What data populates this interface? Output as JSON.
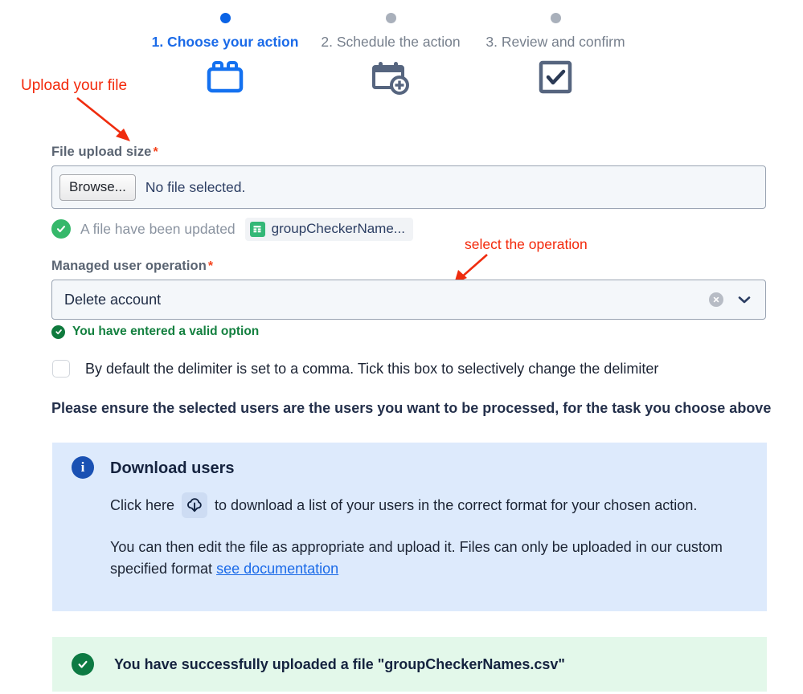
{
  "stepper": {
    "steps": [
      {
        "label": "1. Choose your action",
        "state": "active",
        "icon": "toolbox-icon"
      },
      {
        "label": "2. Schedule the action",
        "state": "inactive",
        "icon": "calendar-add-icon"
      },
      {
        "label": "3. Review and confirm",
        "state": "inactive",
        "icon": "checkbox-confirm-icon"
      }
    ]
  },
  "annotations": {
    "upload": "Upload your file",
    "select": "select the operation"
  },
  "form": {
    "file_upload": {
      "label": "File upload size",
      "required_marker": "*",
      "browse_button": "Browse...",
      "selected_file_text": "No file selected.",
      "status_text": "A file have been updated",
      "chip_name": "groupCheckerName..."
    },
    "operation": {
      "label": "Managed user operation",
      "required_marker": "*",
      "value": "Delete account",
      "validation_text": "You have entered a valid option"
    },
    "delimiter_checkbox": {
      "label": "By default the delimiter is set to a comma. Tick this box to selectively change the delimiter",
      "checked": false
    },
    "ensure_notice": "Please ensure the selected users are the users you want to be processed, for the task you choose above"
  },
  "info_panel": {
    "title": "Download users",
    "line1_before": "Click here",
    "line1_after": "to download a list of your users in the correct format for your chosen action.",
    "line2_text": "You can then edit the file as appropriate and upload it. Files can only be uploaded in our custom specified format",
    "link_text": "see documentation"
  },
  "success_banner": {
    "text": "You have successfully uploaded a file \"groupCheckerNames.csv\""
  },
  "colors": {
    "active_blue": "#1a6ae8",
    "inactive_gray": "#767f8c",
    "accent_red": "#f3290b",
    "success_green": "#0d7a43",
    "info_blue_bg": "#ddeafc",
    "success_bg": "#e3f8ea"
  }
}
